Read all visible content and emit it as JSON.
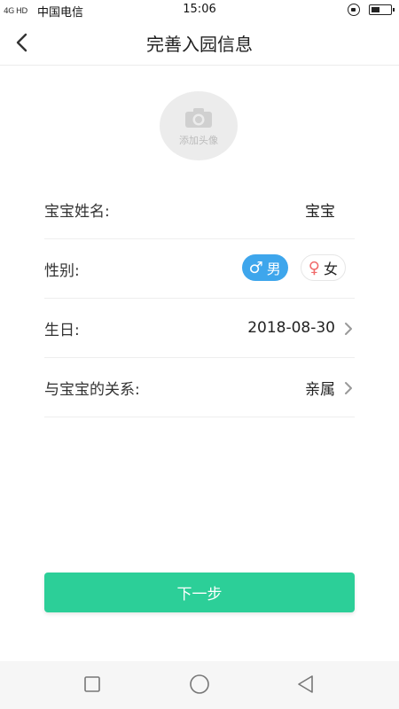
{
  "status_bar": {
    "signal": "4G HD",
    "carrier": "中国电信",
    "time": "15:06"
  },
  "header": {
    "title": "完善入园信息"
  },
  "avatar": {
    "label": "添加头像"
  },
  "form": {
    "name": {
      "label": "宝宝姓名:",
      "value": "宝宝"
    },
    "gender": {
      "label": "性别:",
      "male_symbol": "♂",
      "male": "男",
      "female_symbol": "♀",
      "female": "女",
      "selected": "男"
    },
    "birthday": {
      "label": "生日:",
      "value": "2018-08-30"
    },
    "relation": {
      "label": "与宝宝的关系:",
      "value": "亲属"
    }
  },
  "next_button": {
    "label": "下一步"
  },
  "colors": {
    "accent_green": "#2ccf98",
    "male_blue": "#3ea6ec",
    "female_red": "#f06a6a"
  },
  "icons": [
    "chevron-left-icon",
    "camera-icon",
    "chevron-right-icon",
    "square-icon",
    "circle-icon",
    "triangle-back-icon"
  ]
}
